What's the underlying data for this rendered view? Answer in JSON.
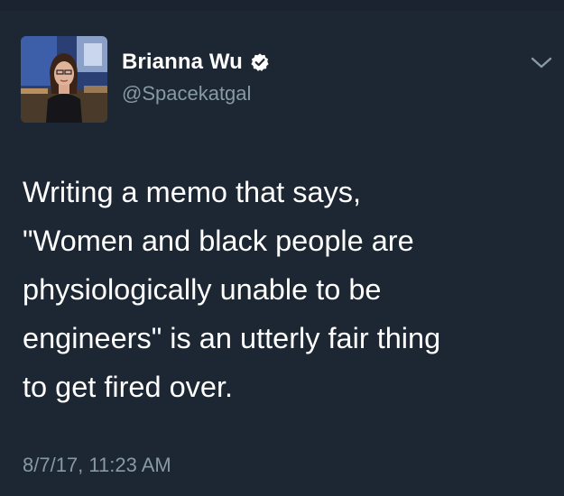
{
  "colors": {
    "background": "#1c2733",
    "text": "#ffffff",
    "secondary_text": "#8899a6",
    "verified_badge": "#ffffff"
  },
  "author": {
    "display_name": "Brianna Wu",
    "handle": "@Spacekatgal",
    "verified": true,
    "avatar_icon": "profile-photo"
  },
  "tweet": {
    "text": "Writing a memo that says,\n\"Women and black people are\nphysiologically unable to be\nengineers\" is an utterly fair thing\nto get fired over.",
    "timestamp": "8/7/17, 11:23 AM"
  },
  "menu": {
    "icon": "chevron-down-icon"
  }
}
